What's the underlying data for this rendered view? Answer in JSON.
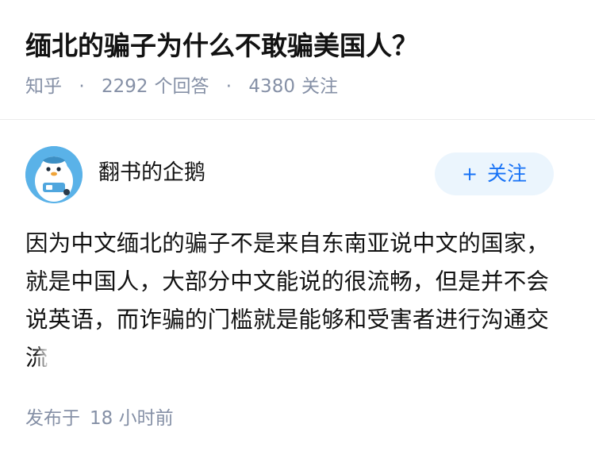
{
  "question": {
    "title": "缅北的骗子为什么不敢骗美国人？",
    "source": "知乎",
    "separator": "·",
    "answer_count": "2292",
    "answer_label": "个回答",
    "follower_count": "4380",
    "follower_label": "关注"
  },
  "author": {
    "name": "翻书的企鹅",
    "avatar_icon": "penguin-avatar-icon",
    "follow_plus": "+",
    "follow_label": "关注"
  },
  "answer": {
    "text_main": "因为中文缅北的骗子不是来自东南亚说中文的国家，就是中国人，大部分中文能说的很流畅，但是并不会说英语，而诈骗的门槛就是能够和受害者进行沟通交",
    "text_tail": "流"
  },
  "footer": {
    "published_label": "发布于",
    "published_time": "18 小时前"
  },
  "colors": {
    "meta_gray": "#8590a6",
    "follow_blue": "#1772f6",
    "follow_bg": "#ebf5fd",
    "avatar_blue": "#5ab2e8"
  }
}
